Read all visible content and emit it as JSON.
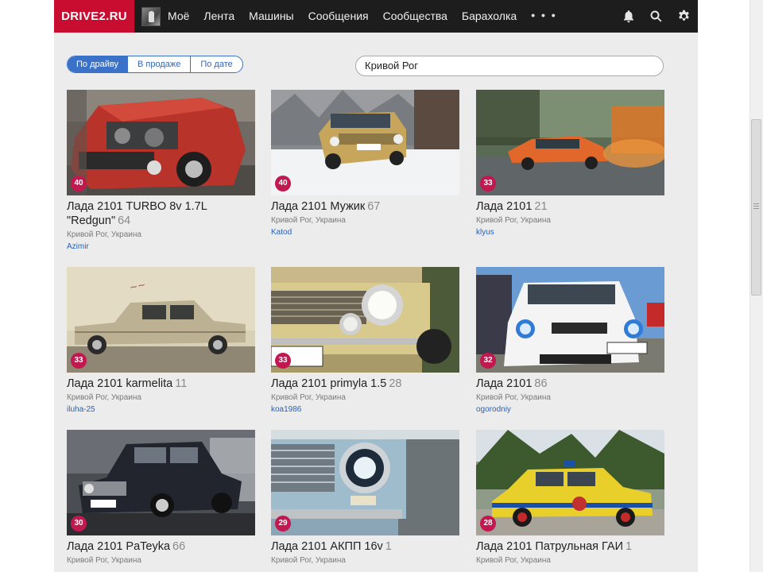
{
  "header": {
    "logo": "DRIVE2.RU",
    "nav": [
      "Моё",
      "Лента",
      "Машины",
      "Сообщения",
      "Сообщества",
      "Барахолка"
    ],
    "more": "• • •"
  },
  "tabs": [
    "По драйву",
    "В продаже",
    "По дате"
  ],
  "search": {
    "value": "Кривой Рог"
  },
  "cards": [
    {
      "title": "Лада 2101 TURBO 8v 1.7L \"Redgun\"",
      "count": "64",
      "badge": "40",
      "location": "Кривой Рог, Украина",
      "user": "Azimir"
    },
    {
      "title": "Лада 2101 Мужик",
      "count": "67",
      "badge": "40",
      "location": "Кривой Рог, Украина",
      "user": "Katod"
    },
    {
      "title": "Лада 2101",
      "count": "21",
      "badge": "33",
      "location": "Кривой Рог, Украина",
      "user": "klyus"
    },
    {
      "title": "Лада 2101 karmelita",
      "count": "11",
      "badge": "33",
      "location": "Кривой Рог, Украина",
      "user": "iluha-25"
    },
    {
      "title": "Лада 2101 primyla 1.5",
      "count": "28",
      "badge": "33",
      "location": "Кривой Рог, Украина",
      "user": "koa1986"
    },
    {
      "title": "Лада 2101",
      "count": "86",
      "badge": "32",
      "location": "Кривой Рог, Украина",
      "user": "ogorodniy"
    },
    {
      "title": "Лада 2101 PaTeyka",
      "count": "66",
      "badge": "30",
      "location": "Кривой Рог, Украина",
      "user": ""
    },
    {
      "title": "Лада 2101 АКПП 16v",
      "count": "1",
      "badge": "29",
      "location": "Кривой Рог, Украина",
      "user": ""
    },
    {
      "title": "Лада 2101 Патрульная ГАИ",
      "count": "1",
      "badge": "28",
      "location": "Кривой Рог, Украина",
      "user": ""
    }
  ],
  "colors": {
    "brand": "#c90d31",
    "topbar": "#1d1d1d",
    "badge": "#c11850",
    "link": "#2a62b4",
    "accent": "#3a72c9"
  },
  "icons": [
    "bell-icon",
    "search-icon",
    "gear-icon"
  ]
}
